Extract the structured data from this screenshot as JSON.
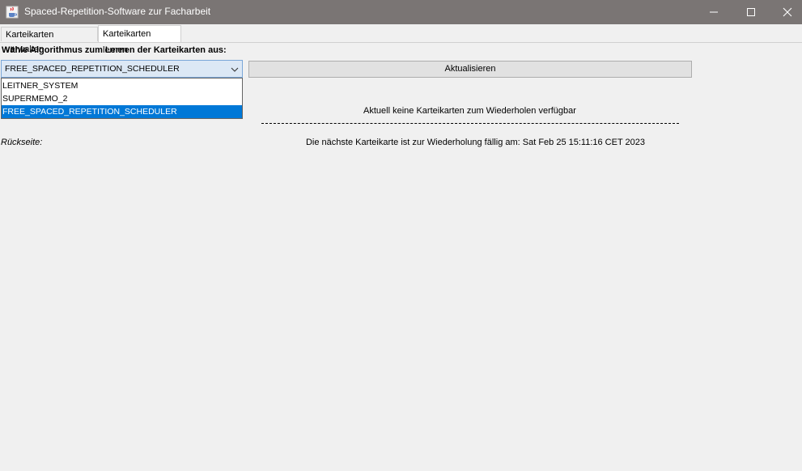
{
  "window": {
    "title": "Spaced-Repetition-Software zur Facharbeit"
  },
  "tabs": [
    {
      "label": "Karteikarten verwalten",
      "active": false
    },
    {
      "label": "Karteikarten lernen",
      "active": true
    }
  ],
  "learn": {
    "heading": "Wähle Algorithmus zum Lernen der Karteikarten aus:",
    "algorithm_select": {
      "value": "FREE_SPACED_REPETITION_SCHEDULER",
      "options": [
        "LEITNER_SYSTEM",
        "SUPERMEMO_2",
        "FREE_SPACED_REPETITION_SCHEDULER"
      ],
      "selected_index": 2
    },
    "refresh_label": "Aktualisieren",
    "status_text": "Aktuell keine Karteikarten zum Wiederholen verfügbar",
    "separator": "--------------------------------------------------------------------------------------------------------------------------------",
    "back_label": "Rückseite:",
    "next_due_text": "Die nächste Karteikarte ist zur Wiederholung fällig am: Sat Feb 25 15:11:16 CET 2023"
  },
  "colors": {
    "titlebar": "#7a7574",
    "selection": "#0078d7",
    "combo_bg": "#dce8f5",
    "window_bg": "#f0f0f0"
  },
  "icons": {
    "app": "java-coffee-cup-icon",
    "minimize": "minimize-icon",
    "maximize": "maximize-icon",
    "close": "close-icon",
    "dropdown": "chevron-down-icon"
  }
}
